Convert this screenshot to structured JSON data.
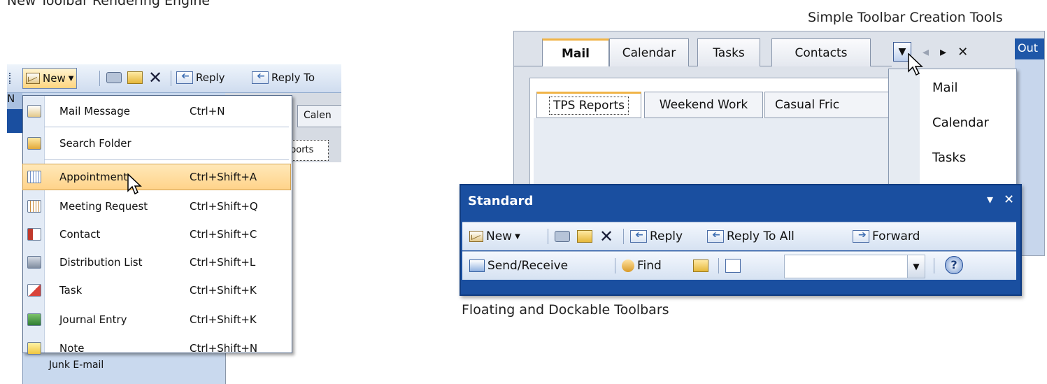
{
  "captions": {
    "top_left": "New Toolbar Rendering Engine",
    "top_right": "Simple Toolbar Creation Tools",
    "bottom_right": "Floating and Dockable Toolbars"
  },
  "left": {
    "toolbar": {
      "new": "New",
      "reply": "Reply",
      "reply_to": "Reply To"
    },
    "nav_letter": "N",
    "calendar_tab": "Calen",
    "reports_tab": "ports",
    "folder_item": "Junk E-mail",
    "menu": [
      {
        "label": "Mail Message",
        "shortcut": "Ctrl+N"
      },
      {
        "label": "Search Folder",
        "shortcut": ""
      },
      {
        "label": "Appointment",
        "shortcut": "Ctrl+Shift+A"
      },
      {
        "label": "Meeting Request",
        "shortcut": "Ctrl+Shift+Q"
      },
      {
        "label": "Contact",
        "shortcut": "Ctrl+Shift+C"
      },
      {
        "label": "Distribution List",
        "shortcut": "Ctrl+Shift+L"
      },
      {
        "label": "Task",
        "shortcut": "Ctrl+Shift+K"
      },
      {
        "label": "Journal Entry",
        "shortcut": "Ctrl+Shift+K"
      },
      {
        "label": "Note",
        "shortcut": "Ctrl+Shift+N"
      }
    ]
  },
  "right": {
    "tabs": [
      "Mail",
      "Calendar",
      "Tasks",
      "Contacts"
    ],
    "inner_tabs": [
      "TPS Reports",
      "Weekend Work",
      "Casual Fric"
    ],
    "out_stub": "Out",
    "tab_menu": [
      "Mail",
      "Calendar",
      "Tasks"
    ],
    "standard": {
      "title": "Standard",
      "row1": {
        "new": "New",
        "reply": "Reply",
        "reply_all": "Reply To All",
        "forward": "Forward"
      },
      "row2": {
        "send_receive": "Send/Receive",
        "find": "Find"
      }
    }
  }
}
